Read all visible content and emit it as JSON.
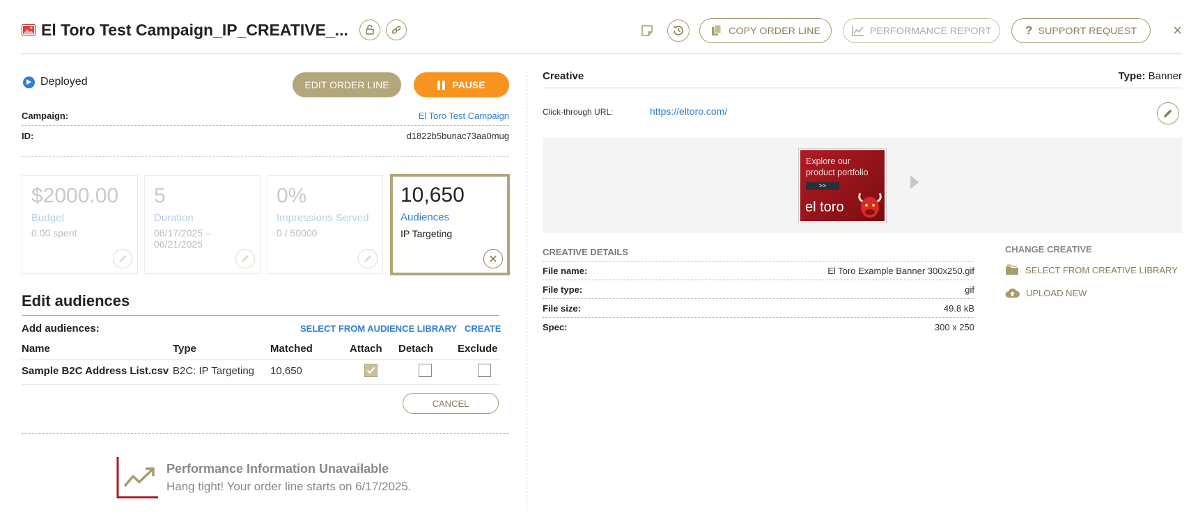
{
  "header": {
    "title": "El Toro Test Campaign_IP_CREATIVE_...",
    "copy_label": "COPY ORDER LINE",
    "performance_label": "PERFORMANCE REPORT",
    "support_label": "SUPPORT REQUEST",
    "close": "×"
  },
  "status": {
    "state": "Deployed",
    "edit_label": "EDIT ORDER LINE",
    "pause_label": "PAUSE"
  },
  "meta": {
    "campaign_label": "Campaign:",
    "campaign_value": "El Toro Test Campaign",
    "id_label": "ID:",
    "id_value": "d1822b5bunac73aa0mug"
  },
  "cards": [
    {
      "value": "$2000.00",
      "label": "Budget",
      "sub": "0.00 spent"
    },
    {
      "value": "5",
      "label": "Duration",
      "sub": "06/17/2025 –",
      "sub2": "06/21/2025"
    },
    {
      "value": "0%",
      "label": "Impressions Served",
      "sub": "0 / 50000"
    },
    {
      "value": "10,650",
      "label": "Audiences",
      "sub": "IP Targeting"
    }
  ],
  "audiences": {
    "title": "Edit audiences",
    "add_label": "Add audiences:",
    "library_link": "SELECT FROM AUDIENCE LIBRARY",
    "create_link": "CREATE",
    "columns": [
      "Name",
      "Type",
      "Matched",
      "Attach",
      "Detach",
      "Exclude"
    ],
    "rows": [
      {
        "name": "Sample B2C Address List.csv",
        "type": "B2C: IP Targeting",
        "matched": "10,650",
        "attach": true,
        "detach": false,
        "exclude": false
      }
    ],
    "cancel_label": "CANCEL"
  },
  "performance": {
    "title": "Performance Information Unavailable",
    "message": "Hang tight! Your order line starts on 6/17/2025."
  },
  "creative": {
    "title": "Creative",
    "type_label": "Type:",
    "type_value": "Banner",
    "clickthrough_label": "Click-through URL:",
    "clickthrough_value": "https://eltoro.com/",
    "banner": {
      "line1": "Explore our",
      "line2": "product portfolio",
      "button": ">>",
      "logo": "el toro"
    },
    "details_title": "CREATIVE DETAILS",
    "details": [
      {
        "k": "File name:",
        "v": "El Toro Example Banner 300x250.gif"
      },
      {
        "k": "File type:",
        "v": "gif"
      },
      {
        "k": "File size:",
        "v": "49.8 kB"
      },
      {
        "k": "Spec:",
        "v": "300 x 250"
      }
    ],
    "change_title": "CHANGE CREATIVE",
    "library_label": "SELECT FROM CREATIVE LIBRARY",
    "upload_label": "UPLOAD NEW"
  },
  "colors": {
    "accent": "#b4a67b",
    "pause": "#f7931e",
    "link": "#2f7fd3"
  }
}
